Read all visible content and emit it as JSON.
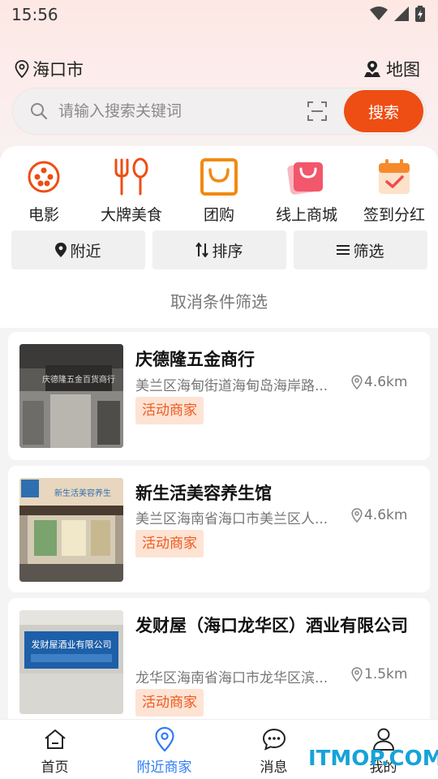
{
  "status": {
    "time": "15:56"
  },
  "location": {
    "city": "海口市",
    "map_label": "地图"
  },
  "search": {
    "placeholder": "请输入搜索关键词",
    "button_label": "搜索"
  },
  "categories": [
    {
      "label": "电影",
      "icon": "film-reel-icon"
    },
    {
      "label": "大牌美食",
      "icon": "fork-spoon-icon"
    },
    {
      "label": "团购",
      "icon": "shopping-bag-icon"
    },
    {
      "label": "线上商城",
      "icon": "pink-bag-icon"
    },
    {
      "label": "签到分红",
      "icon": "calendar-check-icon"
    }
  ],
  "filters": [
    {
      "label": "附近",
      "icon": "location-pin-icon"
    },
    {
      "label": "排序",
      "icon": "sort-arrows-icon"
    },
    {
      "label": "筛选",
      "icon": "menu-lines-icon"
    }
  ],
  "cancel_filter_label": "取消条件筛选",
  "merchants": [
    {
      "name": "庆德隆五金商行",
      "address": "美兰区海甸街道海甸岛海岸路...",
      "distance": "4.6km",
      "tag": "活动商家",
      "thumb_sign": "庆德隆五金百货商行"
    },
    {
      "name": "新生活美容养生馆",
      "address": "美兰区海南省海口市美兰区人...",
      "distance": "4.6km",
      "tag": "活动商家",
      "thumb_sign": "新生活美容养生"
    },
    {
      "name": "发财屋（海口龙华区）酒业有限公司",
      "address": "龙华区海南省海口市龙华区滨...",
      "distance": "1.5km",
      "tag": "活动商家",
      "thumb_sign": "发财屋酒业有限公司"
    }
  ],
  "tabs": [
    {
      "label": "首页",
      "icon": "home-icon",
      "active": false
    },
    {
      "label": "附近商家",
      "icon": "map-pin-icon",
      "active": true
    },
    {
      "label": "消息",
      "icon": "chat-bubble-icon",
      "active": false
    },
    {
      "label": "我的",
      "icon": "user-icon",
      "active": false
    }
  ],
  "watermark": "ITMOP.COM",
  "colors": {
    "accent": "#ee4d13",
    "tag_bg": "#fde3d3",
    "tag_text": "#ee5a22",
    "active_tab": "#2f7cf6"
  }
}
